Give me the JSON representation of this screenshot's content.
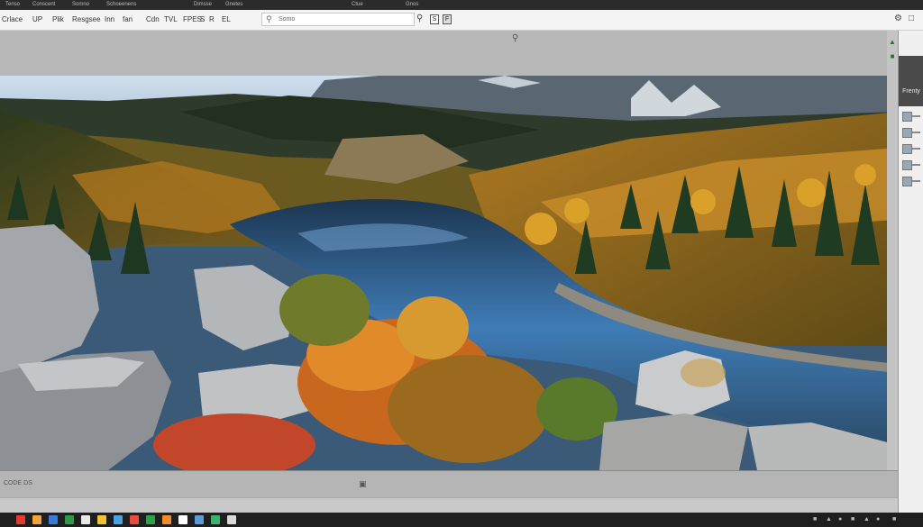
{
  "titlebar": {
    "items": [
      "Tenso",
      "Conscent",
      "Somno",
      "Schoeenens",
      "Dimsse",
      "Gnetes",
      "Ctue",
      "Gnos"
    ]
  },
  "toolbar": {
    "menu": [
      "Crlace",
      "UP",
      "Plik",
      "Resgsee",
      "Inn",
      "fan",
      "Cdn",
      "TVL",
      "FPES",
      "S",
      "R",
      "EL"
    ],
    "field_placeholder": "Somo",
    "buttons": [
      "S",
      "F"
    ]
  },
  "right_panel": {
    "header": "Frenty"
  },
  "statusbar": {
    "text": "CODE DS"
  },
  "icons": {
    "search": "search-icon",
    "zoom": "zoom-icon",
    "close": "close-icon",
    "gear": "gear-icon"
  },
  "colors": {
    "taskbar_icons": [
      "#e23b2e",
      "#f2a33a",
      "#3b7bd8",
      "#2d9a4a",
      "#e8e8e8",
      "#f1c232",
      "#4aa3df",
      "#e94b3c",
      "#2ea04a",
      "#f08c2a",
      "#ffffff",
      "#5c9bd6",
      "#3ab26f",
      "#d9d9d9"
    ]
  }
}
